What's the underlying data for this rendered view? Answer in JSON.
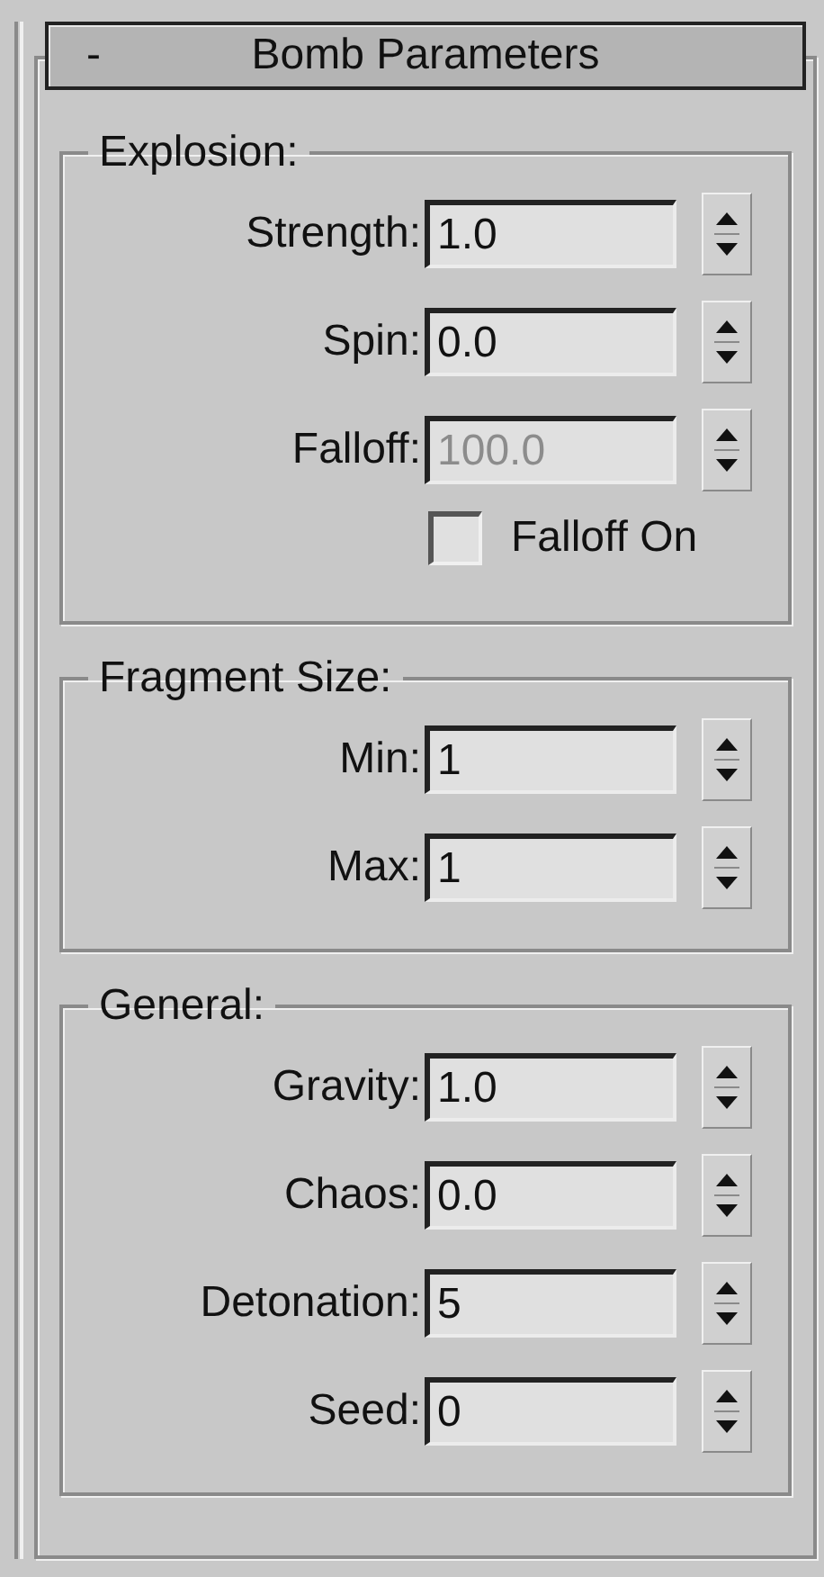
{
  "rollout": {
    "collapse_glyph": "-",
    "title": "Bomb Parameters"
  },
  "groups": [
    {
      "title": "Explosion:",
      "rows": [
        {
          "kind": "spinner",
          "label": "Strength:",
          "value": "1.0",
          "disabled": false
        },
        {
          "kind": "spinner",
          "label": "Spin:",
          "value": "0.0",
          "disabled": false
        },
        {
          "kind": "spinner",
          "label": "Falloff:",
          "value": "100.0",
          "disabled": true
        },
        {
          "kind": "checkbox",
          "label": "Falloff On",
          "checked": false
        }
      ]
    },
    {
      "title": "Fragment Size:",
      "rows": [
        {
          "kind": "spinner",
          "label": "Min:",
          "value": "1",
          "disabled": false
        },
        {
          "kind": "spinner",
          "label": "Max:",
          "value": "1",
          "disabled": false
        }
      ]
    },
    {
      "title": "General:",
      "rows": [
        {
          "kind": "spinner",
          "label": "Gravity:",
          "value": "1.0",
          "disabled": false
        },
        {
          "kind": "spinner",
          "label": "Chaos:",
          "value": "0.0",
          "disabled": false
        },
        {
          "kind": "spinner",
          "label": "Detonation:",
          "value": "5",
          "disabled": false
        },
        {
          "kind": "spinner",
          "label": "Seed:",
          "value": "0",
          "disabled": false
        }
      ]
    }
  ]
}
